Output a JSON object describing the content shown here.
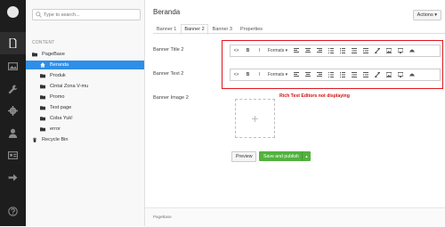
{
  "search": {
    "placeholder": "Type to search..."
  },
  "tree": {
    "section_title": "CONTENT",
    "nodes": [
      {
        "label": "PageBase",
        "icon": "folder-icon",
        "selected": false
      },
      {
        "label": "Beranda",
        "icon": "home-icon",
        "selected": true
      },
      {
        "label": "Produk",
        "icon": "folder-icon",
        "selected": false
      },
      {
        "label": "Cintai Zona V-mu",
        "icon": "folder-icon",
        "selected": false
      },
      {
        "label": "Promo",
        "icon": "folder-icon",
        "selected": false
      },
      {
        "label": "Test page",
        "icon": "folder-icon",
        "selected": false
      },
      {
        "label": "Coba Yuk!",
        "icon": "folder-icon",
        "selected": false
      },
      {
        "label": "error",
        "icon": "folder-icon",
        "selected": false
      },
      {
        "label": "Recycle Bin",
        "icon": "trash-icon",
        "selected": false
      }
    ]
  },
  "editor": {
    "page_title": "Beranda",
    "actions_label": "Actions ▾",
    "tabs": [
      {
        "label": "Banner 1",
        "active": false
      },
      {
        "label": "Banner 2",
        "active": true
      },
      {
        "label": "Banner 3",
        "active": false
      },
      {
        "label": "Properties",
        "active": false
      }
    ],
    "fields": {
      "banner_title_2": "Banner Title 2",
      "banner_text_2": "Banner Text 2",
      "banner_image_2": "Banner Image 2"
    },
    "toolbar": {
      "source": "<>",
      "bold": "B",
      "italic": "I",
      "formats": "Formats ▾"
    },
    "annotation": "Rich Text Editors not displaying",
    "image_placeholder": "+",
    "preview_label": "Preview",
    "save_publish_label": "Save and publish",
    "save_caret": "▲",
    "footer_text": "PageBase"
  },
  "colors": {
    "rail_bg": "#1d1d1d",
    "selected_node": "#2e8ee8",
    "annotation_red": "#e0151d",
    "save_green": "#53b23f"
  }
}
